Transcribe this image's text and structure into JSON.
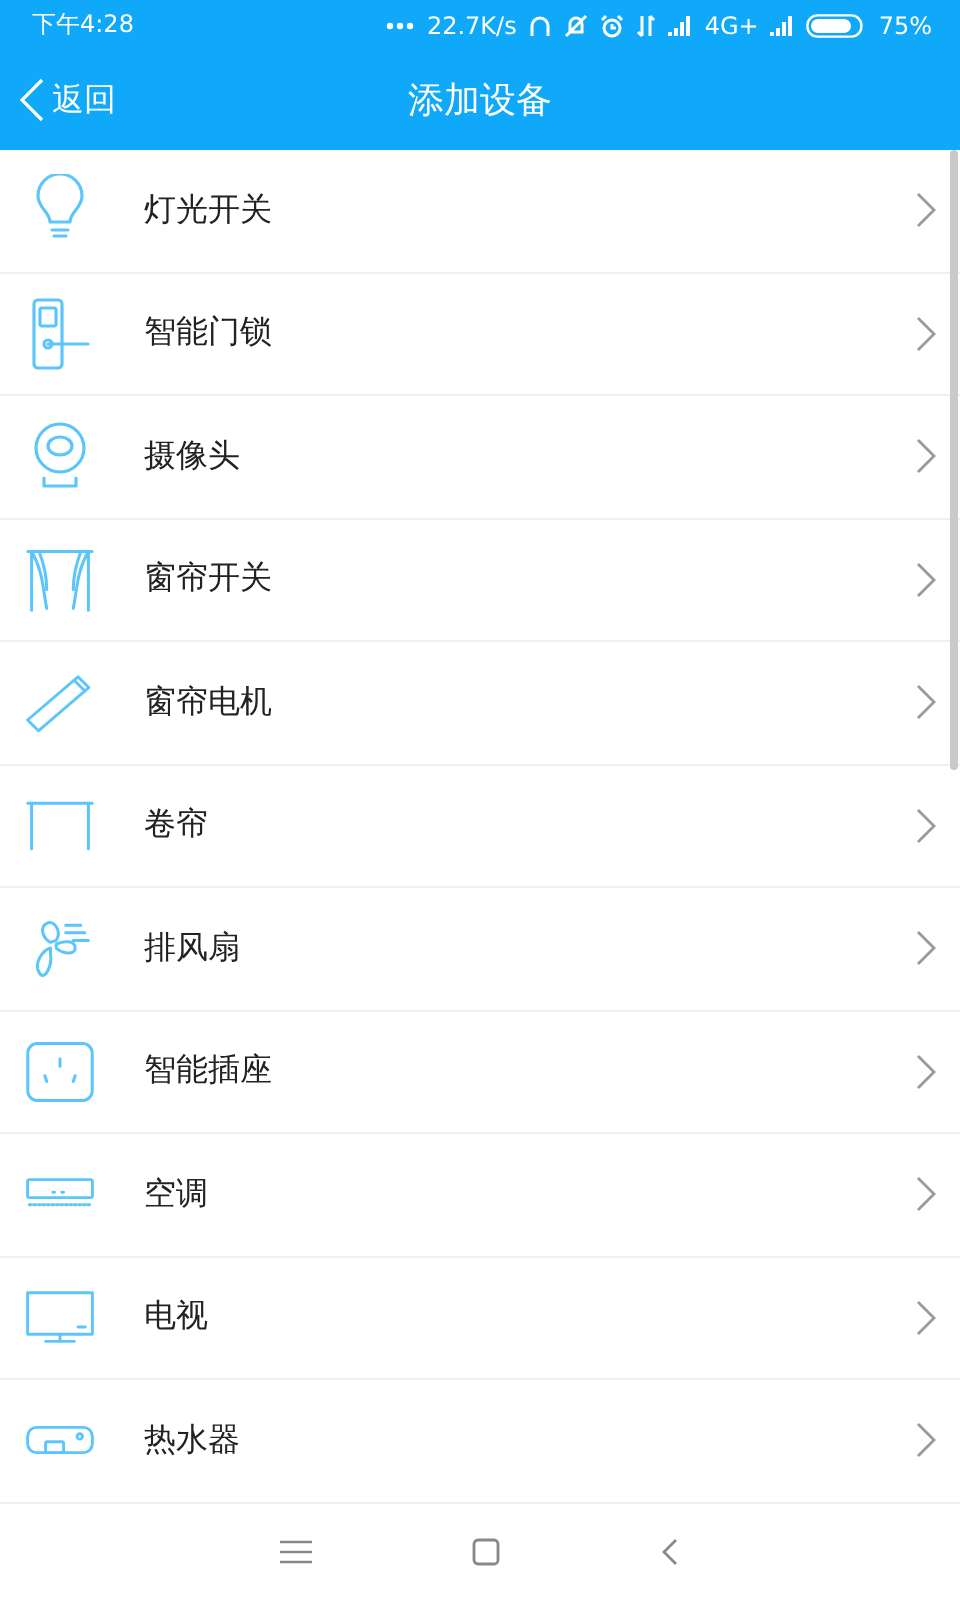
{
  "status_bar": {
    "time": "下午4:28",
    "speed": "22.7K/s",
    "network": "4G+",
    "battery": "75%"
  },
  "header": {
    "back": "返回",
    "title": "添加设备"
  },
  "devices": [
    {
      "kind": "bulb",
      "label": "灯光开关"
    },
    {
      "kind": "lock",
      "label": "智能门锁"
    },
    {
      "kind": "camera",
      "label": "摄像头"
    },
    {
      "kind": "curtain",
      "label": "窗帘开关"
    },
    {
      "kind": "motor",
      "label": "窗帘电机"
    },
    {
      "kind": "blind",
      "label": "卷帘"
    },
    {
      "kind": "fan",
      "label": "排风扇"
    },
    {
      "kind": "socket",
      "label": "智能插座"
    },
    {
      "kind": "ac",
      "label": "空调"
    },
    {
      "kind": "tv",
      "label": "电视"
    },
    {
      "kind": "heater",
      "label": "热水器"
    }
  ]
}
